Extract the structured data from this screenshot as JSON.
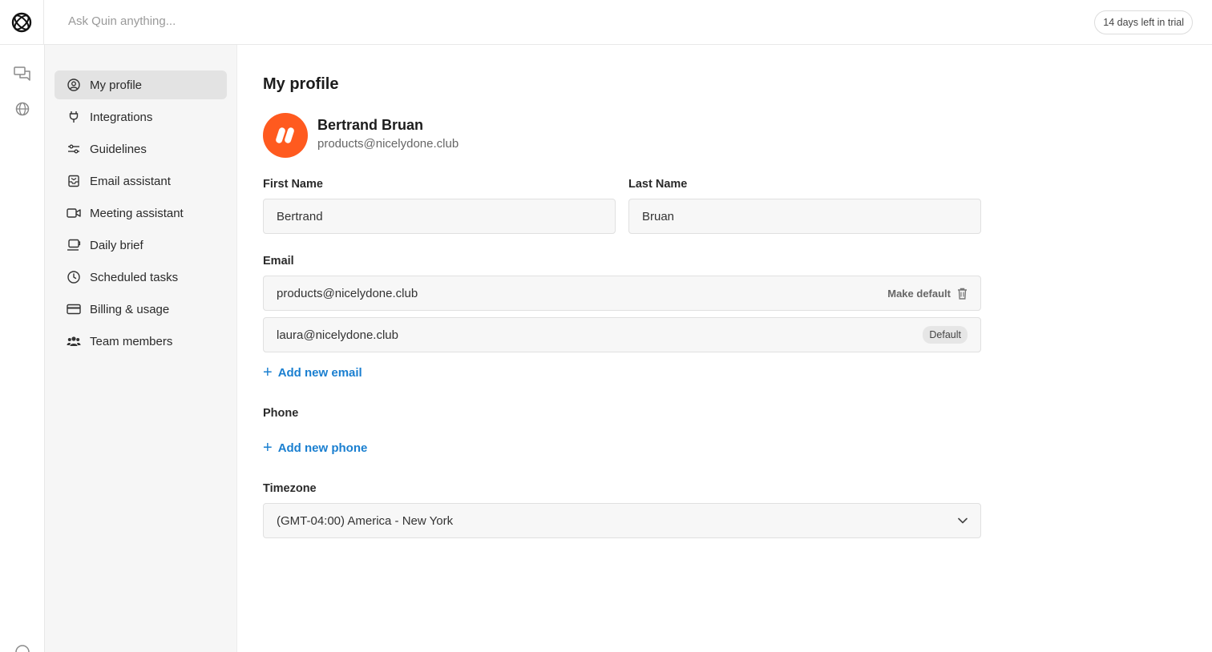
{
  "topbar": {
    "search_placeholder": "Ask Quin anything...",
    "trial_badge": "14 days left in trial"
  },
  "rail": {
    "items": [
      {
        "icon": "chat-icon"
      },
      {
        "icon": "globe-icon"
      }
    ]
  },
  "sidebar": {
    "items": [
      {
        "label": "My profile",
        "icon": "user-circle-icon",
        "active": true
      },
      {
        "label": "Integrations",
        "icon": "plug-icon"
      },
      {
        "label": "Guidelines",
        "icon": "sliders-icon"
      },
      {
        "label": "Email assistant",
        "icon": "inbox-icon"
      },
      {
        "label": "Meeting assistant",
        "icon": "video-icon"
      },
      {
        "label": "Daily brief",
        "icon": "coffee-icon"
      },
      {
        "label": "Scheduled tasks",
        "icon": "clock-icon"
      },
      {
        "label": "Billing & usage",
        "icon": "credit-card-icon"
      },
      {
        "label": "Team members",
        "icon": "team-icon"
      }
    ]
  },
  "profile": {
    "title": "My profile",
    "name": "Bertrand Bruan",
    "email": "products@nicelydone.club",
    "avatar_color": "#ff5a1f"
  },
  "form": {
    "first_name_label": "First Name",
    "first_name_value": "Bertrand",
    "last_name_label": "Last Name",
    "last_name_value": "Bruan",
    "email_label": "Email",
    "emails": [
      {
        "address": "products@nicelydone.club",
        "action": "Make default"
      },
      {
        "address": "laura@nicelydone.club",
        "badge": "Default"
      }
    ],
    "add_email": "Add new email",
    "phone_label": "Phone",
    "add_phone": "Add new phone",
    "timezone_label": "Timezone",
    "timezone_value": "(GMT-04:00) America - New York"
  },
  "colors": {
    "accent": "#1a7fd0",
    "active_nav": "#e3e3e3"
  }
}
